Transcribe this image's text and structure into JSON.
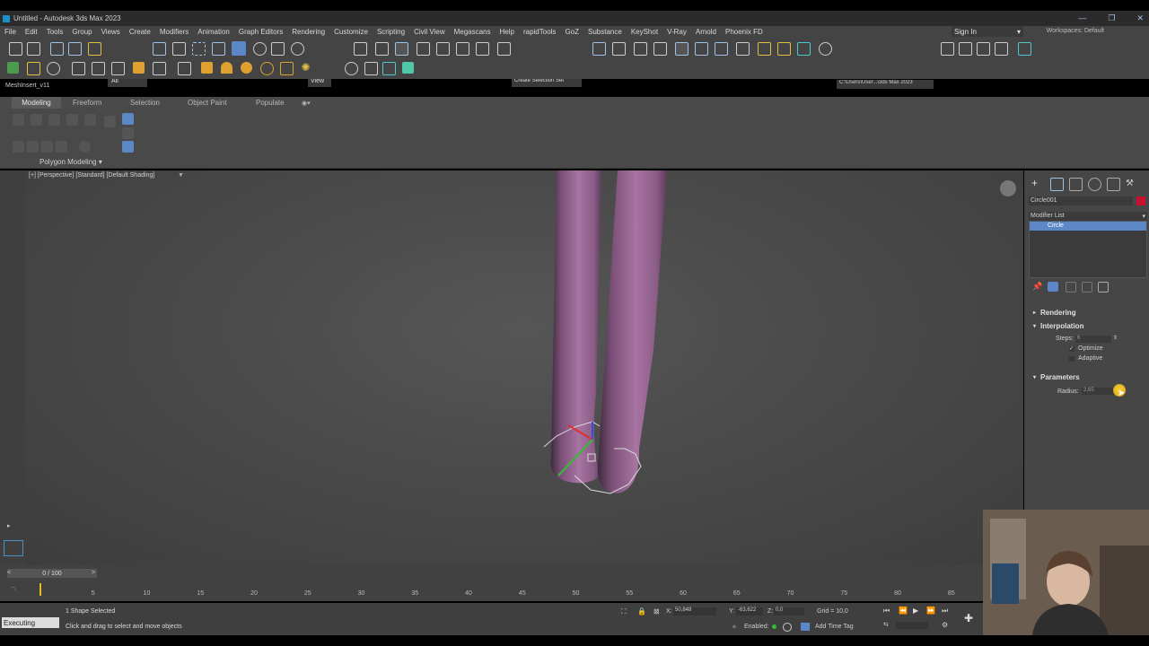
{
  "app": {
    "title": "Untitled - Autodesk 3ds Max 2023",
    "signin": "Sign In",
    "workspaces_label": "Workspaces:",
    "workspace_value": "Default",
    "project_path": "C:\\Users\\User...\\3ds Max 2023"
  },
  "menu": [
    "File",
    "Edit",
    "Tools",
    "Group",
    "Views",
    "Create",
    "Modifiers",
    "Animation",
    "Graph Editors",
    "Rendering",
    "Customize",
    "Scripting",
    "Civil View",
    "Megascans",
    "Help",
    "rapidTools",
    "GoZ",
    "Substance",
    "KeyShot",
    "V-Ray",
    "Arnold",
    "Phoenix FD"
  ],
  "toolbar": {
    "filter_all": "All",
    "view_dropdown": "View",
    "selection_set": "Create Selection Set"
  },
  "meshinsert": "MeshInsert_v11",
  "ribbon": {
    "tabs": [
      "Modeling",
      "Freeform",
      "Selection",
      "Object Paint",
      "Populate"
    ],
    "panel_label": "Polygon Modeling"
  },
  "viewport": {
    "label": "[+] [Perspective] [Standard] [Default Shading]"
  },
  "command_panel": {
    "object_name": "Circle001",
    "modifier_list": "Modifier List",
    "stack_item": "Circle",
    "rollouts": {
      "rendering": "Rendering",
      "interpolation": "Interpolation",
      "parameters": "Parameters"
    },
    "steps_label": "Steps:",
    "steps_value": "6",
    "optimize": "Optimize",
    "adaptive": "Adaptive",
    "radius_label": "Radius:",
    "radius_value": "2,65"
  },
  "timeline": {
    "frame_display": "0 / 100",
    "ticks": [
      "0",
      "5",
      "10",
      "15",
      "20",
      "25",
      "30",
      "35",
      "40",
      "45",
      "50",
      "55",
      "60",
      "65",
      "70",
      "75",
      "80",
      "85"
    ]
  },
  "status": {
    "mini_listener": "Executing",
    "selected": "1 Shape Selected",
    "prompt": "Click and drag to select and move objects",
    "x_label": "X:",
    "x_value": "50,848",
    "y_label": "Y:",
    "y_value": "-63,622",
    "z_label": "Z:",
    "z_value": "0,0",
    "grid": "Grid = 10,0",
    "enabled": "Enabled:",
    "add_time_tag": "Add Time Tag"
  },
  "colors": {
    "object_swatch": "#c8102e",
    "selection_highlight": "#5b87c7",
    "tube_color": "#9b6a96"
  }
}
